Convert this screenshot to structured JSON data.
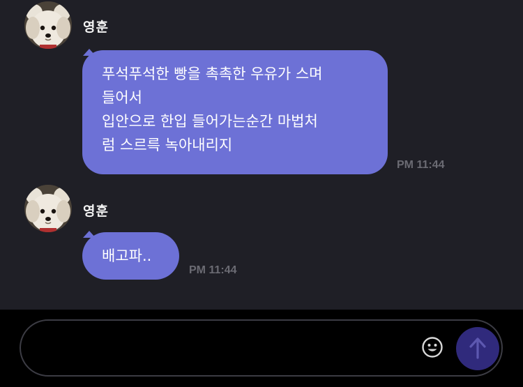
{
  "messages": [
    {
      "sender": "영훈",
      "avatar_icon": "puppy-avatar-icon",
      "text": "푸석푸석한 빵을 촉촉한 우유가 스며\n들어서\n입안으로 한입 들어가는순간 마법처\n럼 스르륵 녹아내리지",
      "time": "PM 11:44"
    },
    {
      "sender": "영훈",
      "avatar_icon": "puppy-avatar-icon",
      "text": "배고파..",
      "time": "PM 11:44"
    }
  ],
  "composer": {
    "placeholder": "",
    "emoji_icon": "smiley-icon",
    "send_icon": "arrow-up-icon"
  },
  "colors": {
    "background": "#1f1f26",
    "bubble": "#6d71d6",
    "send_button": "#302a7c",
    "timestamp": "#6b6b73"
  }
}
